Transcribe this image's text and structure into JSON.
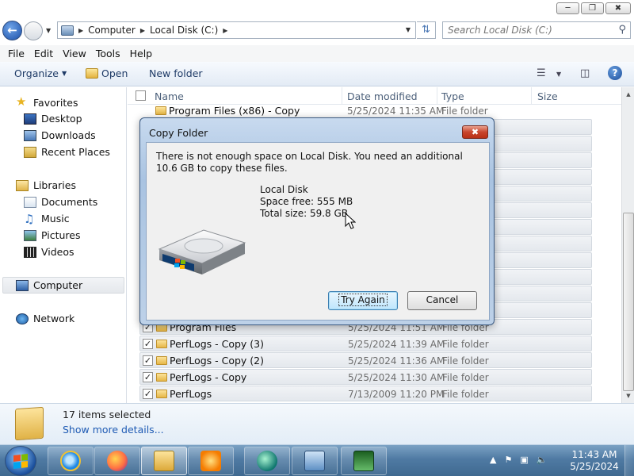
{
  "window": {
    "minimize": "─",
    "maximize": "❐",
    "close": "✖"
  },
  "address": {
    "crumbs": [
      "Computer",
      "Local Disk (C:)"
    ]
  },
  "search": {
    "placeholder": "Search Local Disk (C:)"
  },
  "menu": [
    "File",
    "Edit",
    "View",
    "Tools",
    "Help"
  ],
  "toolbar": {
    "organize": "Organize",
    "open": "Open",
    "new_folder": "New folder"
  },
  "nav": {
    "favorites": "Favorites",
    "desktop": "Desktop",
    "downloads": "Downloads",
    "recent": "Recent Places",
    "libraries": "Libraries",
    "documents": "Documents",
    "music": "Music",
    "pictures": "Pictures",
    "videos": "Videos",
    "computer": "Computer",
    "network": "Network"
  },
  "columns": {
    "name": "Name",
    "date": "Date modified",
    "type": "Type",
    "size": "Size"
  },
  "files": [
    {
      "name": "Program Files (x86) - Copy",
      "date": "5/25/2024 11:35 AM",
      "type": "File folder",
      "checked": false
    },
    {
      "name": "Program Files",
      "date": "5/25/2024 11:51 AM",
      "type": "File folder",
      "checked": true
    },
    {
      "name": "PerfLogs - Copy (3)",
      "date": "5/25/2024 11:39 AM",
      "type": "File folder",
      "checked": true
    },
    {
      "name": "PerfLogs - Copy (2)",
      "date": "5/25/2024 11:36 AM",
      "type": "File folder",
      "checked": true
    },
    {
      "name": "PerfLogs - Copy",
      "date": "5/25/2024 11:30 AM",
      "type": "File folder",
      "checked": true
    },
    {
      "name": "PerfLogs",
      "date": "7/13/2009 11:20 PM",
      "type": "File folder",
      "checked": true
    }
  ],
  "details": {
    "count": "17 items selected",
    "more": "Show more details..."
  },
  "dialog": {
    "title": "Copy Folder",
    "message": "There is not enough space on Local Disk. You need an additional 10.6 GB to copy these files.",
    "disk_name": "Local Disk",
    "free": "Space free: 555 MB",
    "total": "Total size: 59.8 GB",
    "try_again": "Try Again",
    "cancel": "Cancel"
  },
  "taskbar": {
    "time": "11:43 AM",
    "date": "5/25/2024"
  }
}
